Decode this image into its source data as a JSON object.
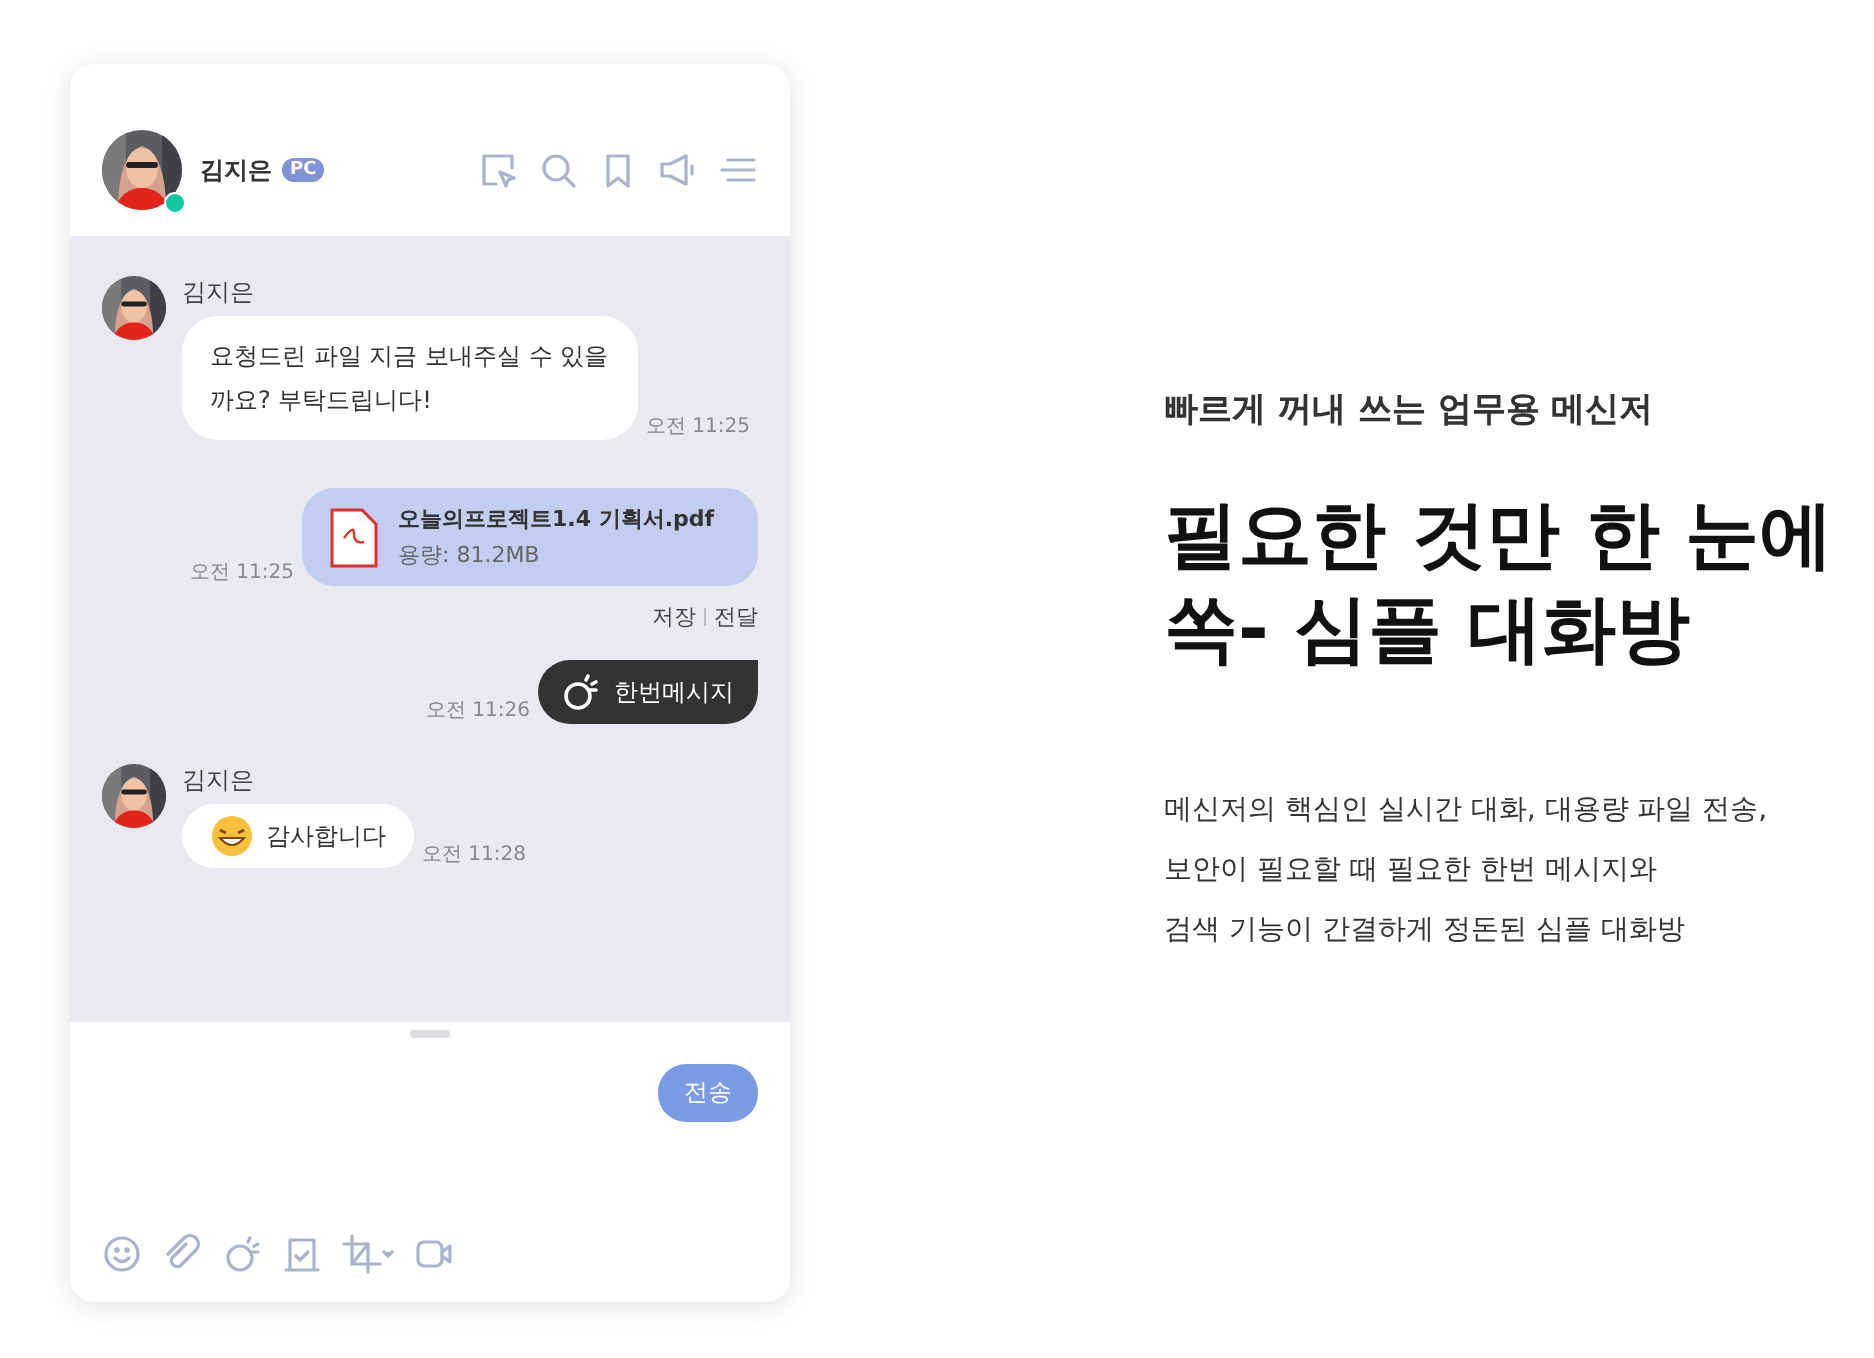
{
  "chat_header": {
    "name": "김지은",
    "badge": "PC",
    "online": true
  },
  "messages": [
    {
      "kind": "text",
      "sender": "김지은",
      "text": "요청드린 파일 지금 보내주실 수 있을까요? 부탁드립니다!",
      "time": "오전 11:25"
    },
    {
      "kind": "file",
      "file_name": "오늘의프로젝트1.4 기획서.pdf",
      "file_size": "용량: 81.2MB",
      "time": "오전 11:25",
      "actions": [
        "저장",
        "전달"
      ]
    },
    {
      "kind": "once",
      "text": "한번메시지",
      "time": "오전 11:26"
    },
    {
      "kind": "emoji",
      "sender": "김지은",
      "text": "감사합니다",
      "time": "오전 11:28"
    }
  ],
  "composer": {
    "send_button": "전송"
  },
  "promo": {
    "subtitle": "빠르게 꺼내 쓰는 업무용 메신저",
    "headline": [
      "필요한 것만 한 눈에",
      "쏙- 심플 대화방"
    ],
    "description": [
      "메신저의 핵심인 실시간 대화, 대용량 파일 전송,",
      "보안이 필요할 때 필요한 한번 메시지와",
      "검색 기능이 간결하게 정돈된 심플 대화방"
    ]
  }
}
